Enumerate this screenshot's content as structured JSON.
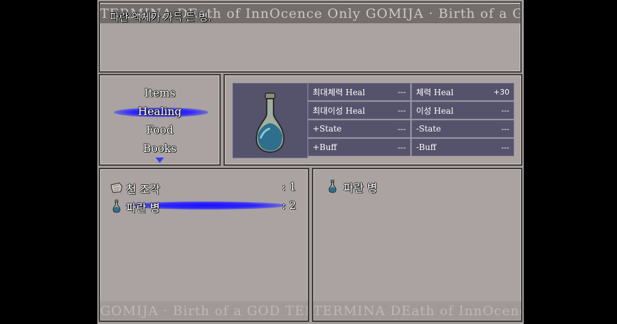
{
  "help": {
    "description": "파란 액체가 가득 든 병.",
    "banner_top": "TERMINA  DEath of InnOcence  Only GOMIJA  · Birth of a GOD  TERMINA",
    "banner_bottom": "GOMIJA · Birth of a GOD  TERMINA  · DEath of InnOcence  Only"
  },
  "categories": {
    "items": [
      "Items",
      "Healing",
      "Food",
      "Books"
    ],
    "selected": "Healing"
  },
  "stats": [
    {
      "label": "최대체력 Heal",
      "value": "---"
    },
    {
      "label": "체력 Heal",
      "value": "+30"
    },
    {
      "label": "최대이성 Heal",
      "value": "---"
    },
    {
      "label": "이성 Heal",
      "value": "---"
    },
    {
      "label": "+State",
      "value": "---"
    },
    {
      "label": "-State",
      "value": "---"
    },
    {
      "label": "+Buff",
      "value": "---"
    },
    {
      "label": "-Buff",
      "value": "---"
    }
  ],
  "inventory": [
    {
      "name": "천 조각",
      "qty": ": 1",
      "icon": "cloth-icon"
    },
    {
      "name": "파란 병",
      "qty": ": 2",
      "icon": "blue-bottle-icon"
    }
  ],
  "preview": {
    "name": "파란 병",
    "icon": "blue-bottle-icon"
  },
  "colors": {
    "highlight": "#2f27ff",
    "stat_cell": "#55526b",
    "panel": "#aaa3a1"
  }
}
